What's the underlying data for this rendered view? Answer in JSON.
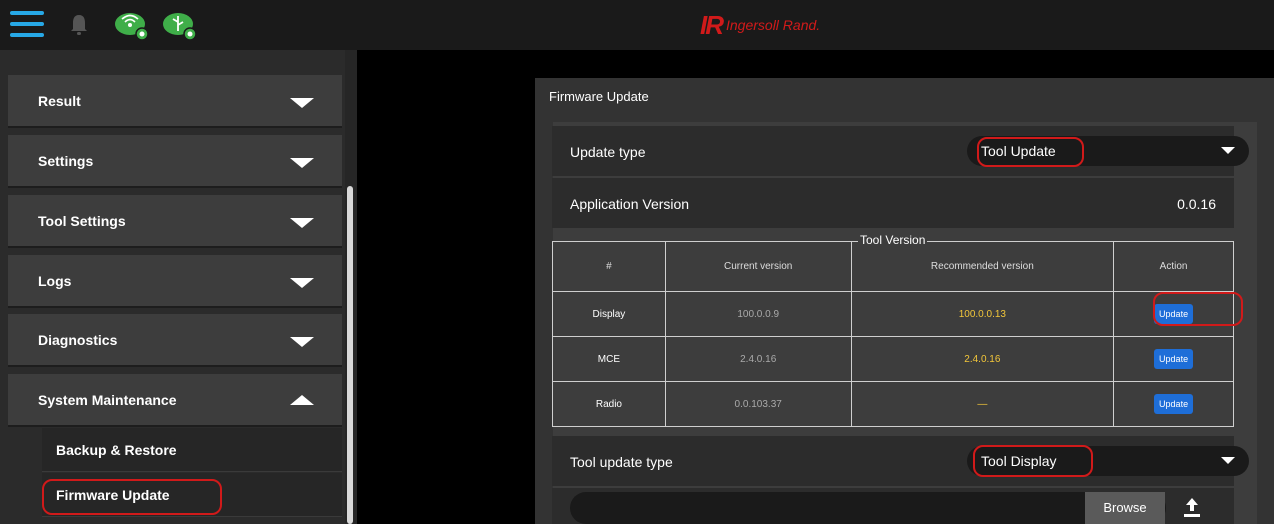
{
  "brand": {
    "logo_mark": "IR",
    "logo_name": "Ingersoll Rand."
  },
  "sidebar": {
    "items": [
      {
        "label": "Result"
      },
      {
        "label": "Settings"
      },
      {
        "label": "Tool Settings"
      },
      {
        "label": "Logs"
      },
      {
        "label": "Diagnostics"
      },
      {
        "label": "System Maintenance"
      }
    ],
    "sub_items": [
      {
        "label": "Backup & Restore"
      },
      {
        "label": "Firmware Update"
      }
    ]
  },
  "panel": {
    "title": "Firmware Update",
    "update_type": {
      "label": "Update type",
      "value": "Tool Update"
    },
    "app_version": {
      "label": "Application Version",
      "value": "0.0.16"
    },
    "table": {
      "legend": "Tool Version",
      "headers": [
        "#",
        "Current version",
        "Recommended version",
        "Action"
      ],
      "rows": [
        {
          "name": "Display",
          "current": "100.0.0.9",
          "recommended": "100.0.0.13",
          "action": "Update"
        },
        {
          "name": "MCE",
          "current": "2.4.0.16",
          "recommended": "2.4.0.16",
          "action": "Update"
        },
        {
          "name": "Radio",
          "current": "0.0.103.37",
          "recommended": "—",
          "action": "Update"
        }
      ]
    },
    "tool_update_type": {
      "label": "Tool update type",
      "value": "Tool Display"
    },
    "file": {
      "browse_label": "Browse"
    }
  },
  "colors": {
    "accent": "#27a8e6",
    "highlight": "#d11a1a",
    "update_button": "#1e6ed8",
    "recommended_text": "#f2c63a",
    "connected": "#3fae49"
  }
}
